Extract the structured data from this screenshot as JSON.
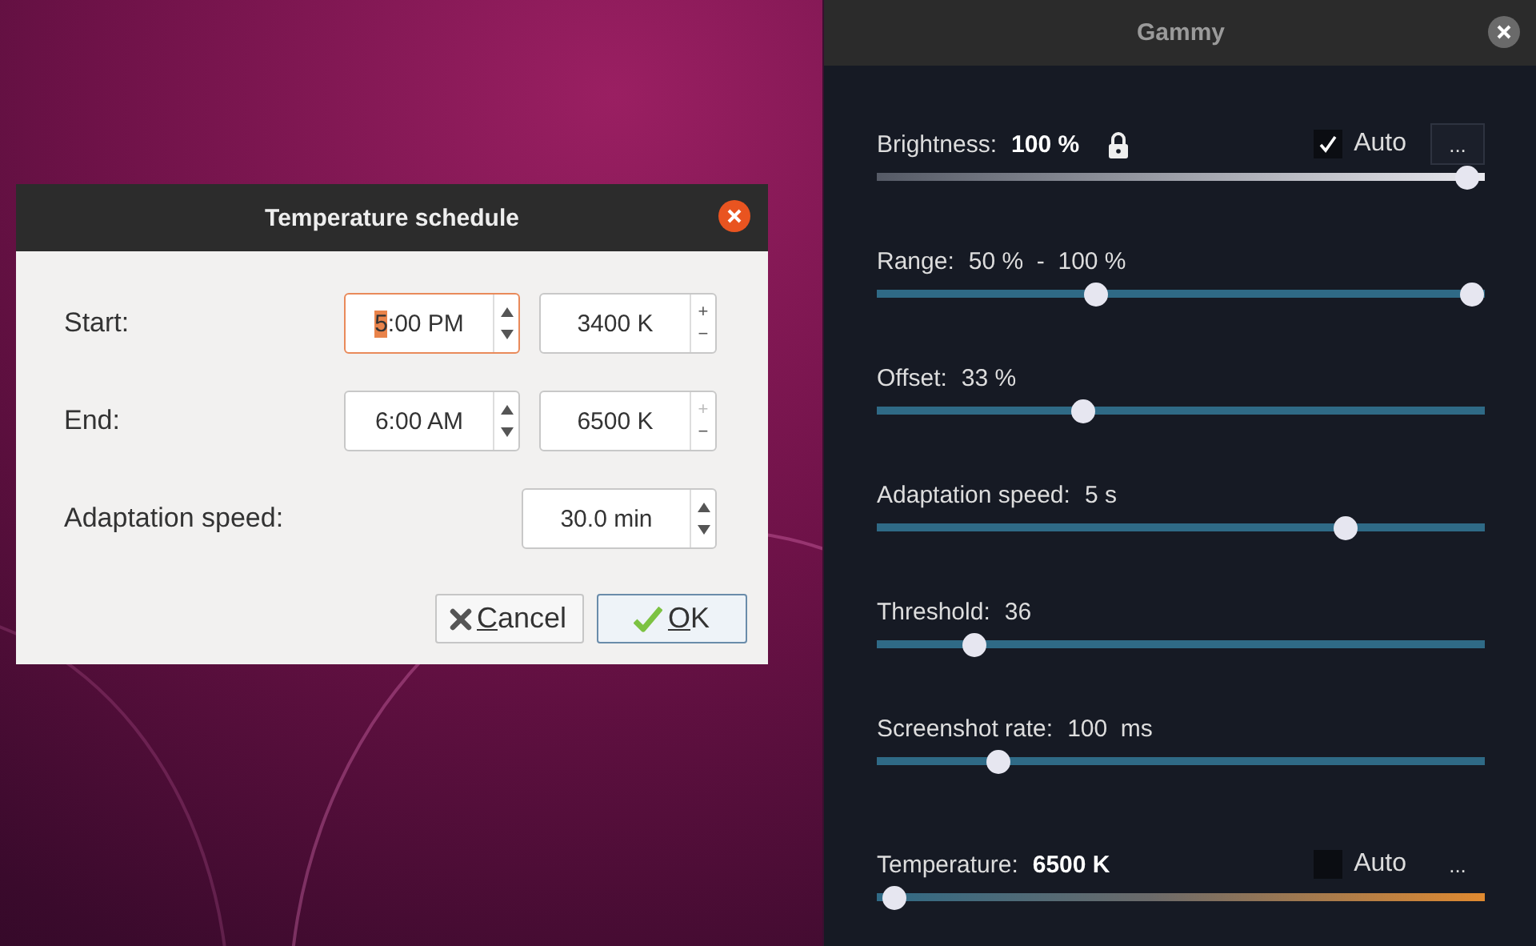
{
  "schedule_dialog": {
    "title": "Temperature schedule",
    "rows": [
      {
        "kind": "pair",
        "label": "Start:",
        "time": {
          "selected_part": "5",
          "rest": ":00 PM",
          "focused": true
        },
        "temperature": {
          "value": "3400 K",
          "plus": "+",
          "minus": "−",
          "plus_disabled": false
        }
      },
      {
        "kind": "pair",
        "label": "End:",
        "time": {
          "rest": "6:00 AM",
          "focused": false
        },
        "temperature": {
          "value": "6500 K",
          "plus": "+",
          "minus": "−",
          "plus_disabled": true
        }
      },
      {
        "kind": "single",
        "label": "Adaptation speed:",
        "value": "30.0 min"
      }
    ],
    "buttons": [
      {
        "kind": "cancel",
        "mnemonic": "C",
        "rest": "ancel",
        "default": false
      },
      {
        "kind": "ok",
        "mnemonic": "O",
        "rest": "K",
        "default": true
      }
    ]
  },
  "gammy_window": {
    "title": "Gammy",
    "rows": [
      {
        "kind": "brightness",
        "label": "Brightness:",
        "value": "100 %",
        "locked": true,
        "auto": {
          "label": "Auto",
          "checked": true
        },
        "more": {
          "label": "...",
          "framed": true
        },
        "level": 0.97
      },
      {
        "kind": "range",
        "label": "Range:",
        "value": "50 %  -  100 %",
        "thumbs": [
          {
            "level": 0.36
          },
          {
            "level": 0.98
          }
        ]
      },
      {
        "kind": "plain",
        "label": "Offset:",
        "value": "33 %",
        "level": 0.34
      },
      {
        "kind": "plain",
        "label": "Adaptation speed:",
        "value": "5 s",
        "level": 0.77
      },
      {
        "kind": "plain",
        "label": "Threshold:",
        "value": "36",
        "level": 0.16
      },
      {
        "kind": "plain",
        "label": "Screenshot rate:",
        "value": "100  ms",
        "level": 0.2
      },
      {
        "kind": "temperature",
        "label": "Temperature:",
        "value": "6500 K",
        "auto": {
          "label": "Auto",
          "checked": false
        },
        "more": {
          "label": "...",
          "framed": false
        },
        "level": 0.03
      }
    ]
  }
}
